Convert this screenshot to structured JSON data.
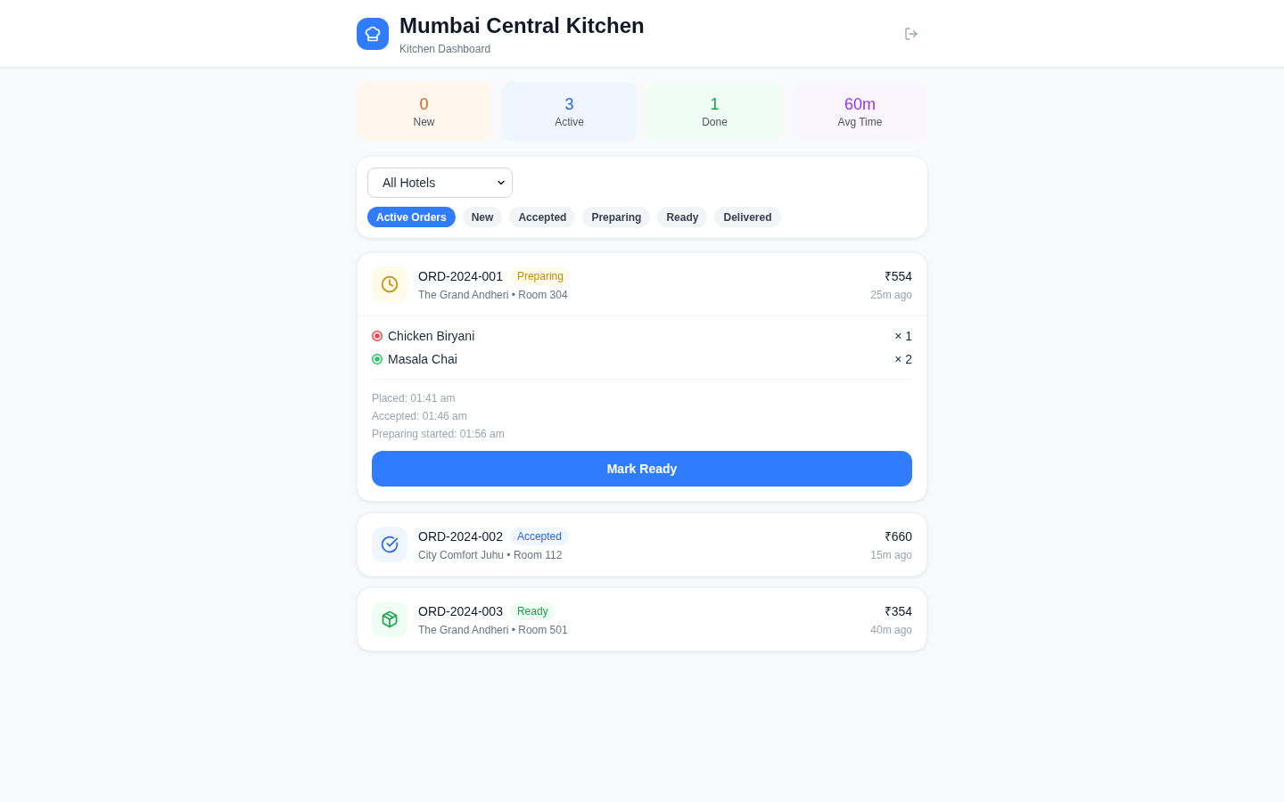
{
  "header": {
    "title": "Mumbai Central Kitchen",
    "subtitle": "Kitchen Dashboard"
  },
  "stats": [
    {
      "kind": "new",
      "value": "0",
      "label": "New"
    },
    {
      "kind": "active",
      "value": "3",
      "label": "Active"
    },
    {
      "kind": "done",
      "value": "1",
      "label": "Done"
    },
    {
      "kind": "time",
      "value": "60m",
      "label": "Avg Time"
    }
  ],
  "filters": {
    "hotel_select": {
      "value": "All Hotels"
    },
    "tabs": [
      {
        "label": "Active Orders",
        "selected": true
      },
      {
        "label": "New",
        "selected": false
      },
      {
        "label": "Accepted",
        "selected": false
      },
      {
        "label": "Preparing",
        "selected": false
      },
      {
        "label": "Ready",
        "selected": false
      },
      {
        "label": "Delivered",
        "selected": false
      }
    ]
  },
  "orders": [
    {
      "id": "ORD-2024-001",
      "status": {
        "kind": "preparing",
        "label": "Preparing"
      },
      "location": "The Grand Andheri • Room 304",
      "total": "₹554",
      "age": "25m ago",
      "expanded": true,
      "items": [
        {
          "name": "Chicken Biryani",
          "quantity": "× 1",
          "color": "#ef4444"
        },
        {
          "name": "Masala Chai",
          "quantity": "× 2",
          "color": "#22c55e"
        }
      ],
      "timeline": [
        "Placed: 01:41 am",
        "Accepted: 01:46 am",
        "Preparing started: 01:56 am"
      ],
      "action": "Mark Ready"
    },
    {
      "id": "ORD-2024-002",
      "status": {
        "kind": "accepted",
        "label": "Accepted"
      },
      "location": "City Comfort Juhu • Room 112",
      "total": "₹660",
      "age": "15m ago",
      "expanded": false
    },
    {
      "id": "ORD-2024-003",
      "status": {
        "kind": "ready",
        "label": "Ready"
      },
      "location": "The Grand Andheri • Room 501",
      "total": "₹354",
      "age": "40m ago",
      "expanded": false
    }
  ]
}
